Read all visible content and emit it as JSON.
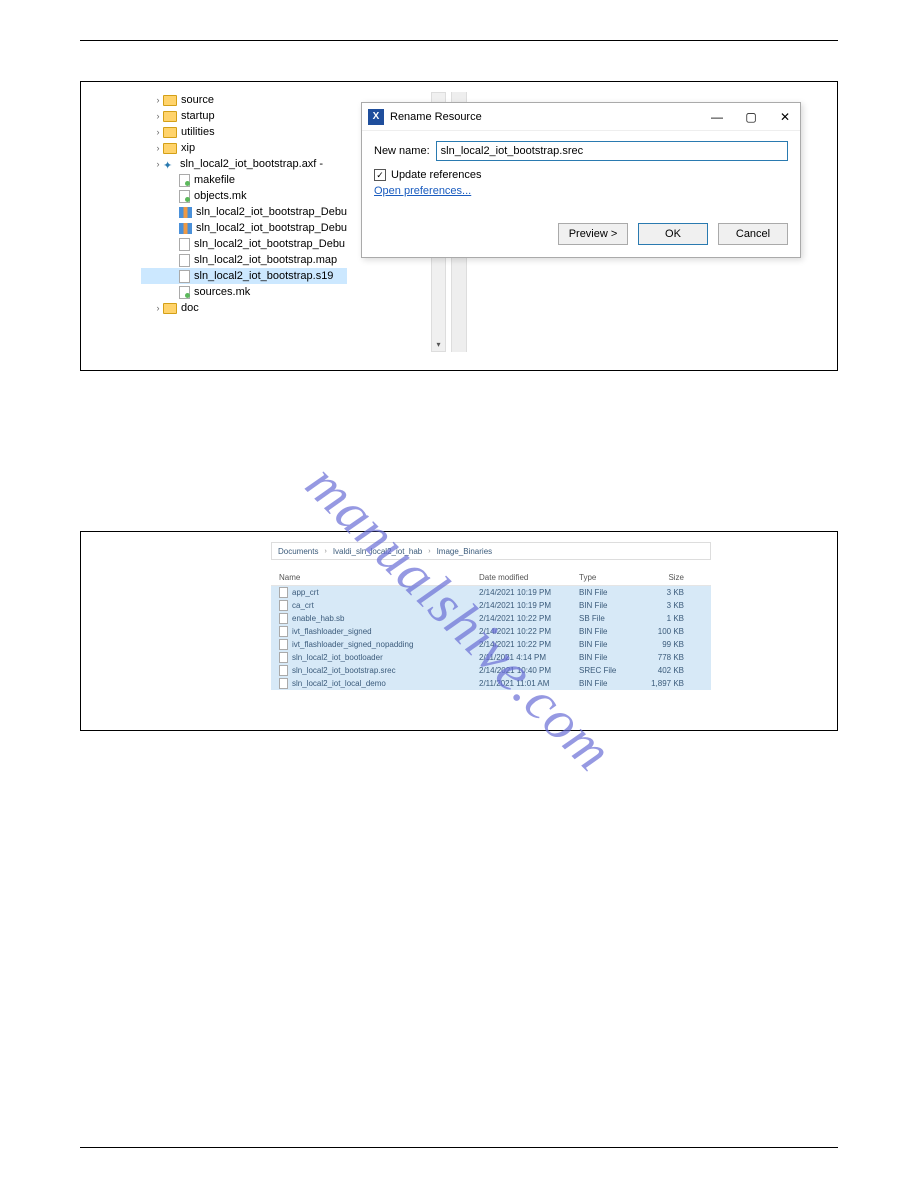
{
  "watermark": "manualshive.com",
  "figure1": {
    "tree": [
      {
        "depth": 1,
        "expandable": true,
        "icon": "folder",
        "label": "source"
      },
      {
        "depth": 1,
        "expandable": true,
        "icon": "folder",
        "label": "startup"
      },
      {
        "depth": 1,
        "expandable": true,
        "icon": "folder",
        "label": "utilities"
      },
      {
        "depth": 1,
        "expandable": true,
        "icon": "folder",
        "label": "xip"
      },
      {
        "depth": 1,
        "expandable": true,
        "icon": "axf",
        "label": "sln_local2_iot_bootstrap.axf -"
      },
      {
        "depth": 2,
        "expandable": false,
        "icon": "file-green",
        "label": "makefile"
      },
      {
        "depth": 2,
        "expandable": false,
        "icon": "file-green",
        "label": "objects.mk"
      },
      {
        "depth": 2,
        "expandable": false,
        "icon": "bin",
        "label": "sln_local2_iot_bootstrap_Debu"
      },
      {
        "depth": 2,
        "expandable": false,
        "icon": "bin",
        "label": "sln_local2_iot_bootstrap_Debu"
      },
      {
        "depth": 2,
        "expandable": false,
        "icon": "file",
        "label": "sln_local2_iot_bootstrap_Debu"
      },
      {
        "depth": 2,
        "expandable": false,
        "icon": "file",
        "label": "sln_local2_iot_bootstrap.map"
      },
      {
        "depth": 2,
        "expandable": false,
        "icon": "file",
        "label": "sln_local2_iot_bootstrap.s19",
        "selected": true
      },
      {
        "depth": 2,
        "expandable": false,
        "icon": "file-green",
        "label": "sources.mk"
      },
      {
        "depth": 1,
        "expandable": true,
        "icon": "folder",
        "label": "doc"
      }
    ],
    "dialog": {
      "title": "Rename Resource",
      "new_name_label": "New name:",
      "new_name_value": "sln_local2_iot_bootstrap.srec",
      "update_refs_label": "Update references",
      "update_refs_checked": true,
      "open_prefs": "Open preferences...",
      "preview_btn": "Preview >",
      "ok_btn": "OK",
      "cancel_btn": "Cancel"
    }
  },
  "figure2": {
    "breadcrumbs": [
      "Documents",
      "Ivaldi_sln_local2_iot_hab",
      "Image_Binaries"
    ],
    "headers": {
      "name": "Name",
      "date": "Date modified",
      "type": "Type",
      "size": "Size"
    },
    "files": [
      {
        "name": "app_crt",
        "date": "2/14/2021 10:19 PM",
        "type": "BIN File",
        "size": "3 KB"
      },
      {
        "name": "ca_crt",
        "date": "2/14/2021 10:19 PM",
        "type": "BIN File",
        "size": "3 KB"
      },
      {
        "name": "enable_hab.sb",
        "date": "2/14/2021 10:22 PM",
        "type": "SB File",
        "size": "1 KB"
      },
      {
        "name": "ivt_flashloader_signed",
        "date": "2/14/2021 10:22 PM",
        "type": "BIN File",
        "size": "100 KB"
      },
      {
        "name": "ivt_flashloader_signed_nopadding",
        "date": "2/14/2021 10:22 PM",
        "type": "BIN File",
        "size": "99 KB"
      },
      {
        "name": "sln_local2_iot_bootloader",
        "date": "2/11/2021 4:14 PM",
        "type": "BIN File",
        "size": "778 KB"
      },
      {
        "name": "sln_local2_iot_bootstrap.srec",
        "date": "2/14/2021 10:40 PM",
        "type": "SREC File",
        "size": "402 KB"
      },
      {
        "name": "sln_local2_iot_local_demo",
        "date": "2/11/2021 11:01 AM",
        "type": "BIN File",
        "size": "1,897 KB"
      }
    ]
  }
}
